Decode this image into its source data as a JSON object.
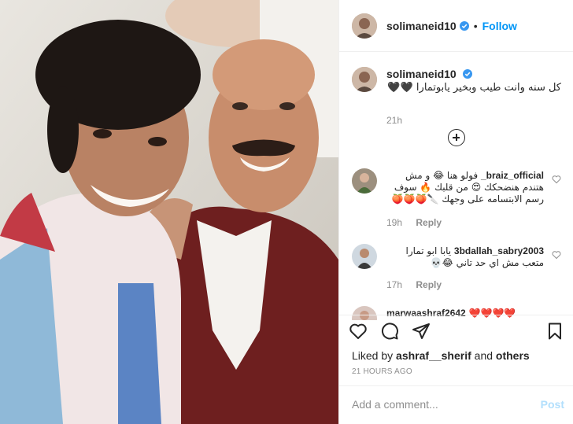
{
  "post": {
    "username": "solimaneid10",
    "follow_label": "Follow",
    "dot": "•",
    "caption_text": "كل سنه وانت طيب وبخير يابوتمارا 🖤🖤",
    "caption_time": "21h"
  },
  "comments": [
    {
      "username": "_braiz_official",
      "text": "فولو هنا 😂 و مش هتندم هنضحكك 😍 من قلبك 🔥 سوف رسم الابتسامه على وجهك 🔪🍑🍑🍑",
      "time": "19h",
      "reply_label": "Reply"
    },
    {
      "username": "3bdallah_sabry2003",
      "text": "يابا ابو تمارا متعب مش اي حد تاني 😂💀",
      "time": "17h",
      "reply_label": "Reply"
    },
    {
      "username": "marwaashraf2642",
      "text": "❤️❤️❤️❤️",
      "time": "",
      "reply_label": ""
    }
  ],
  "actions": {
    "liked_prefix": "Liked by",
    "liked_user": "ashraf__sherif",
    "liked_and": "and",
    "liked_others": "others",
    "time_ago": "21 HOURS AGO"
  },
  "add_comment": {
    "placeholder": "Add a comment...",
    "post_label": "Post"
  },
  "icons": {
    "verified": "verified-badge-icon",
    "like": "heart-icon",
    "comment": "comment-icon",
    "share": "share-icon",
    "save": "bookmark-icon",
    "load_more": "plus-circle-icon"
  },
  "colors": {
    "accent": "#0095f6",
    "muted": "#8e8e8e",
    "post_disabled": "#b2dffc",
    "border": "#efefef"
  }
}
